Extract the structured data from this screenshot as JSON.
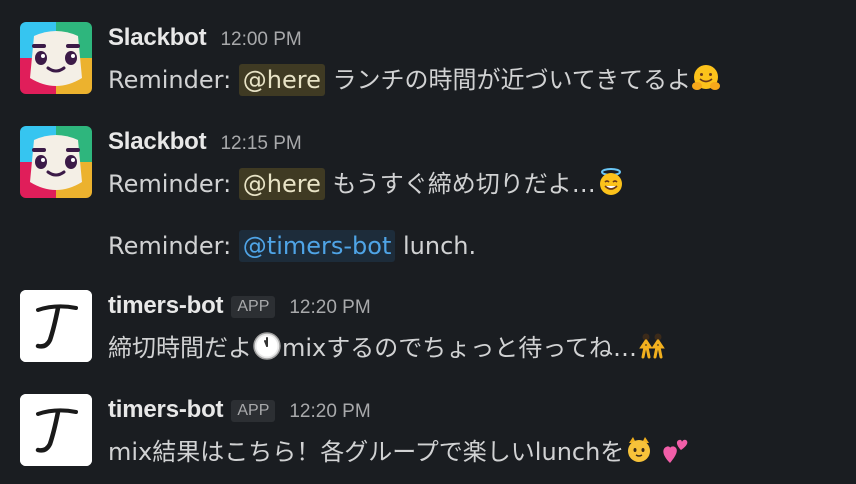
{
  "messages": [
    {
      "sender": "Slackbot",
      "time": "12:00 PM",
      "prefix": "Reminder: ",
      "mention": "@here",
      "text": " ランチの時間が近づいてきてるよ",
      "emoji": "hugging-face-emoji"
    },
    {
      "sender": "Slackbot",
      "time": "12:15 PM",
      "prefix": "Reminder: ",
      "mention": "@here",
      "text": " もうすぐ締め切りだよ…",
      "emoji": "smiling-face-with-halo-emoji"
    },
    {
      "prefix": "Reminder: ",
      "mention": "@timers-bot",
      "text": " lunch."
    },
    {
      "sender": "timers-bot",
      "badge": "APP",
      "time": "12:20 PM",
      "text_before": "締切時間だよ",
      "emoji_mid": "clock-emoji",
      "text_after": "mixするのでちょっと待ってね…",
      "emoji": "dancers-emoji"
    },
    {
      "sender": "timers-bot",
      "badge": "APP",
      "time": "12:20 PM",
      "text": "mix結果はこちら！各グループで楽しいlunchを",
      "emoji_1": "cat-face-emoji",
      "emoji_2": "two-hearts-emoji"
    }
  ],
  "colors": {
    "background": "#1a1d21",
    "mention_here_bg": "#3f3a23",
    "mention_user_bg": "#1d2c3a",
    "mention_user_fg": "#4fa4e6"
  }
}
